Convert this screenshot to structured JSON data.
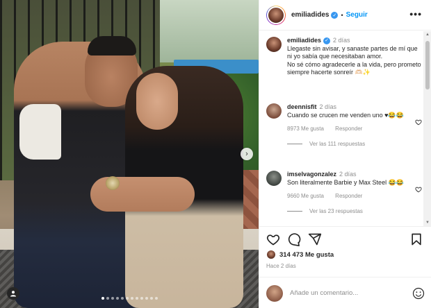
{
  "post": {
    "username": "emiliadides",
    "follow_label": "Seguir",
    "separator": "•",
    "more_label": "•••",
    "caption": {
      "time": "2 días",
      "text": "Llegaste sin avisar, y sanaste partes de mí que ni yo sabía que necesitaban amor.\nNo sé cómo agradecerle a la vida, pero prometo siempre hacerte sonreír 🫶🏻✨"
    }
  },
  "comments": [
    {
      "username": "deennisfit",
      "time": "2 días",
      "text": "Cuando se crucen me venden uno ♥😂😂",
      "likes": "8973 Me gusta",
      "reply_label": "Responder",
      "replies": "Ver las 111 respuestas"
    },
    {
      "username": "imselvagonzalez",
      "time": "2 días",
      "text": "Son literalmente Barbie y Max Steel 😂😂",
      "likes": "9660 Me gusta",
      "reply_label": "Responder",
      "replies": "Ver las 23 respuestas"
    }
  ],
  "actions": {
    "likes_count": "314 473 Me gusta",
    "posted_ago": "Hace 2 días"
  },
  "comment_box": {
    "placeholder": "Añade un comentario..."
  },
  "carousel": {
    "next_label": "›",
    "slide_count": 12,
    "active_slide": 1
  },
  "icons": {
    "like": "heart-icon",
    "comment": "comment-icon",
    "share": "share-icon",
    "save": "bookmark-icon",
    "emoji": "emoji-icon",
    "tag": "user-tag-icon"
  },
  "colors": {
    "accent": "#0095f6",
    "verified": "#3897f0",
    "text": "#262626",
    "muted": "#8e8e8e"
  }
}
